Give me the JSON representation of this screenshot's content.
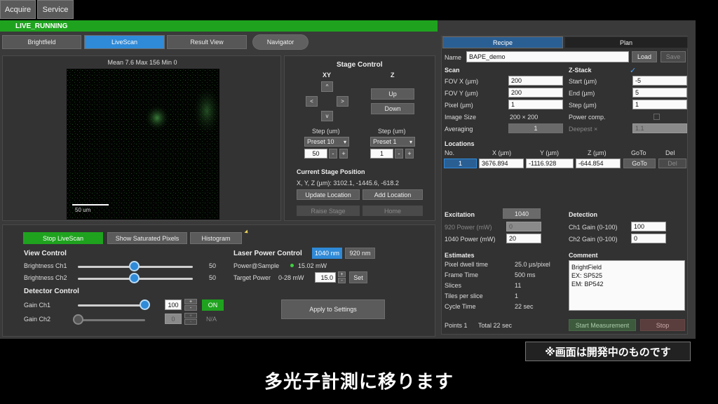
{
  "menu": {
    "acquire": "Acquire",
    "service": "Service"
  },
  "status": "LIVE_RUNNING",
  "tabs": {
    "brightfield": "Brightfield",
    "livescan": "LiveScan",
    "result_view": "Result View",
    "navigator": "Navigator"
  },
  "image_stats": "Mean 7.6   Max 156   Min 0",
  "scalebar_label": "50 um",
  "stage": {
    "title": "Stage Control",
    "xy_label": "XY",
    "z_label": "Z",
    "up_arrow": "^",
    "down_arrow": "v",
    "left_arrow": "<",
    "right_arrow": ">",
    "z_up": "Up",
    "z_down": "Down",
    "step_label_xy": "Step (um)",
    "step_label_z": "Step (um)",
    "preset_xy": "Preset 10",
    "preset_z": "Preset 1",
    "step_xy": "50",
    "step_z": "1",
    "minus": "-",
    "plus": "+",
    "current_title": "Current Stage Position",
    "current_value": "X, Y, Z (µm): 3102.1, -1445.6, -618.2",
    "update_location": "Update Location",
    "add_location": "Add Location",
    "raise_stage": "Raise Stage",
    "home": "Home"
  },
  "controls": {
    "stop_livescan": "Stop LiveScan",
    "show_saturated": "Show Saturated Pixels",
    "histogram": "Histogram",
    "view_control": "View Control",
    "brightness_ch1": "Brightness Ch1",
    "brightness_ch1_value": "50",
    "brightness_ch2": "Brightness Ch2",
    "brightness_ch2_value": "50",
    "detector_control": "Detector Control",
    "gain_ch1": "Gain Ch1",
    "gain_ch1_value": "100",
    "gain_ch1_state": "ON",
    "gain_ch2": "Gain Ch2",
    "gain_ch2_value": "0",
    "gain_ch2_state": "N/A",
    "plus": "+",
    "minus": "-",
    "laser_power_control": "Laser Power Control",
    "wl_1040": "1040 nm",
    "wl_920": "920 nm",
    "power_at_sample_label": "Power@Sample",
    "power_at_sample_value": "15.02 mW",
    "target_power_label": "Target Power",
    "target_power_range": "0-28 mW",
    "target_power_value": "15.0",
    "set": "Set",
    "apply": "Apply to Settings"
  },
  "right": {
    "tab_recipe": "Recipe",
    "tab_plan": "Plan",
    "name_label": "Name",
    "name_value": "BAPE_demo",
    "load": "Load",
    "save": "Save",
    "scan_title": "Scan",
    "fov_x_label": "FOV X (µm)",
    "fov_x_value": "200",
    "fov_y_label": "FOV Y (µm)",
    "fov_y_value": "200",
    "pixel_label": "Pixel (µm)",
    "pixel_value": "1",
    "image_size_label": "Image Size",
    "image_size_value": "200 × 200",
    "averaging_label": "Averaging",
    "averaging_value": "1",
    "zstack_title": "Z-Stack",
    "zstack_check": "✓",
    "start_label": "Start (µm)",
    "start_value": "-5",
    "end_label": "End (µm)",
    "end_value": "5",
    "step_label": "Step (µm)",
    "step_value": "1",
    "power_comp_label": "Power comp.",
    "deepest_label": "Deepest ×",
    "deepest_value": "1.1",
    "locations_title": "Locations",
    "loc_headers": {
      "no": "No.",
      "x": "X (µm)",
      "y": "Y (µm)",
      "z": "Z (µm)",
      "goto": "GoTo",
      "del": "Del"
    },
    "loc_row": {
      "no": "1",
      "x": "3676.894",
      "y": "-1116.928",
      "z": "-644.854",
      "goto": "GoTo",
      "del": "Del"
    },
    "excitation_title": "Excitation",
    "excitation_value": "1040",
    "p920_label": "920 Power (mW)",
    "p920_value": "0",
    "p1040_label": "1040 Power (mW)",
    "p1040_value": "20",
    "detection_title": "Detection",
    "ch1_gain_label": "Ch1 Gain (0-100)",
    "ch1_gain_value": "100",
    "ch2_gain_label": "Ch2 Gain (0-100)",
    "ch2_gain_value": "0",
    "estimates_title": "Estimates",
    "est_dwell_label": "Pixel dwell time",
    "est_dwell_value": "25.0 µs/pixel",
    "est_frame_label": "Frame Time",
    "est_frame_value": "500 ms",
    "est_slices_label": "Slices",
    "est_slices_value": "11",
    "est_tiles_label": "Tiles per slice",
    "est_tiles_value": "1",
    "est_cycle_label": "Cycle Time",
    "est_cycle_value": "22 sec",
    "comment_title": "Comment",
    "comment_lines": [
      "BrightField",
      "EX: SP525",
      "EM: BP542"
    ],
    "points": "Points 1",
    "total": "Total  22 sec",
    "start_measurement": "Start Measurement",
    "stop": "Stop"
  },
  "overlay_note": "※画面は開発中のものです",
  "subtitle": "多光子計測に移ります"
}
